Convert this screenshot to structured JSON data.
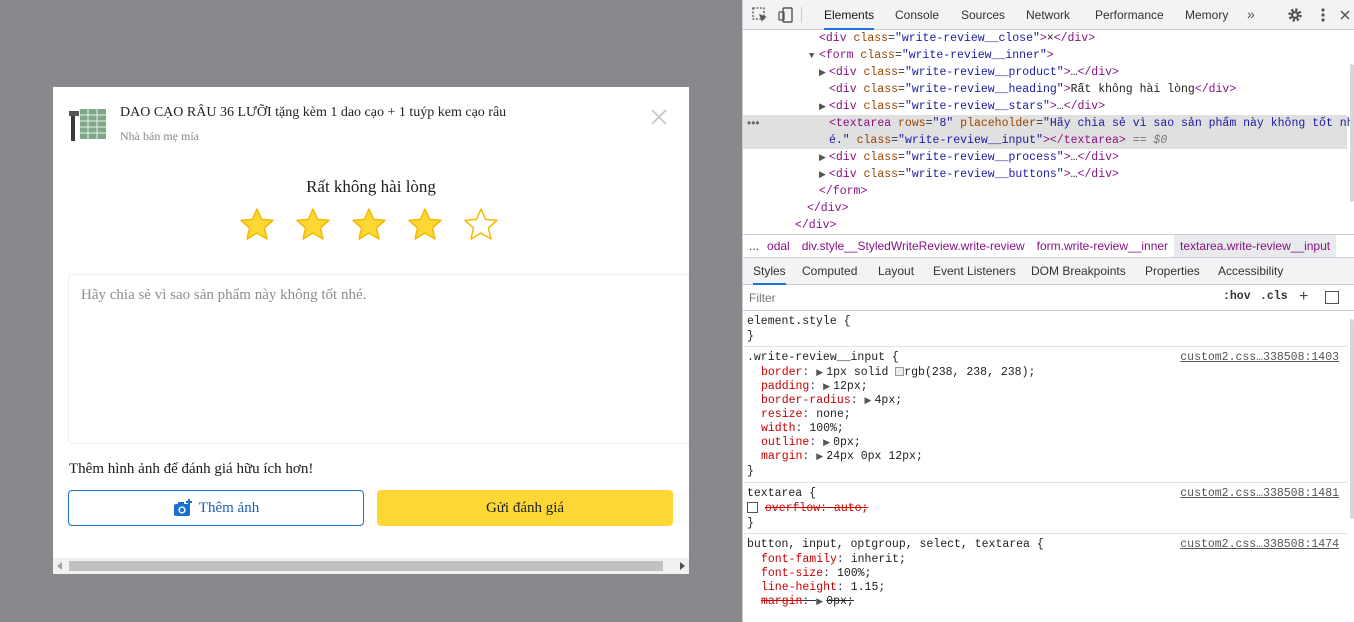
{
  "modal": {
    "product_name": "DAO CẠO RÂU 36 LƯỠI tặng kèm 1 dao cạo + 1 tuýp kem cạo râu",
    "seller": "Nhà bán mẹ mía",
    "close_glyph": "×",
    "heading": "Rất không hài lòng",
    "rating": 4,
    "rating_max": 5,
    "review_placeholder": "Hãy chia sẻ vì sao sản phẩm này không tốt nhé.",
    "process_text": "Thêm hình ảnh để đánh giá hữu ích hơn!",
    "add_photo_label": "Thêm ảnh",
    "submit_label": "Gửi đánh giá",
    "colors": {
      "star": "#fdd835",
      "star_stroke": "#f5b800",
      "submit_bg": "#fdd835",
      "add_border": "#1a73c8",
      "backdrop": "#88898c"
    }
  },
  "devtools": {
    "tabs": [
      "Elements",
      "Console",
      "Sources",
      "Network",
      "Performance",
      "Memory"
    ],
    "active_tab": "Elements",
    "more_tabs": "»",
    "dom": {
      "l1": {
        "tag": "div",
        "class_attr": "class",
        "class_val": "\"write-review__close\"",
        "text": "×",
        "close": "</div>"
      },
      "l2": {
        "tag": "form",
        "class_attr": "class",
        "class_val": "\"write-review__inner\""
      },
      "l3": {
        "tag": "div",
        "class_attr": "class",
        "class_val": "\"write-review__product\"",
        "text": "…",
        "close": "</div>"
      },
      "l4": {
        "tag": "div",
        "class_attr": "class",
        "class_val": "\"write-review__heading\"",
        "text": "Rất không hài lòng",
        "close": "</div>"
      },
      "l5": {
        "tag": "div",
        "class_attr": "class",
        "class_val": "\"write-review__stars\"",
        "text": "…",
        "close": "</div>"
      },
      "l6": {
        "tag": "textarea",
        "rows_attr": "rows",
        "rows_val": "\"8\"",
        "ph_attr": "placeholder",
        "ph_val_1": "\"Hãy chia sẻ vì sao sản phẩm này không tốt nh",
        "ph_val_2": "é.\"",
        "class_attr": "class",
        "class_val": "\"write-review__input\"",
        "close": "</textarea>",
        "eq": "== $0"
      },
      "l7": {
        "tag": "div",
        "class_attr": "class",
        "class_val": "\"write-review__process\"",
        "text": "…",
        "close": "</div>"
      },
      "l8": {
        "tag": "div",
        "class_attr": "class",
        "class_val": "\"write-review__buttons\"",
        "text": "…",
        "close": "</div>"
      },
      "l9": "</form>",
      "l10": "</div>",
      "l11": "</div>"
    },
    "gutter_dots": "•••",
    "breadcrumbs": {
      "dots": "...",
      "items": [
        "odal",
        "div.style__StyledWriteReview.write-review",
        "form.write-review__inner",
        "textarea.write-review__input"
      ]
    },
    "subtabs": [
      "Styles",
      "Computed",
      "Layout",
      "Event Listeners",
      "DOM Breakpoints",
      "Properties",
      "Accessibility"
    ],
    "active_subtab": "Styles",
    "filter_placeholder": "Filter",
    "hov": ":hov",
    "cls": ".cls",
    "plus": "+",
    "styles": {
      "element_style": "element.style {",
      "brace_close": "}",
      "rule1": {
        "selector": ".write-review__input {",
        "source": "custom2.css…338508:1403",
        "props": [
          {
            "name": "border",
            "value": "1px solid ",
            "extra": "rgb(238, 238, 238);"
          },
          {
            "name": "padding",
            "value": "12px;"
          },
          {
            "name": "border-radius",
            "value": "4px;"
          },
          {
            "name": "resize",
            "value": "none;"
          },
          {
            "name": "width",
            "value": "100%;"
          },
          {
            "name": "outline",
            "value": "0px;"
          },
          {
            "name": "margin",
            "value": "24px 0px 12px;"
          }
        ]
      },
      "rule2": {
        "selector": "textarea {",
        "source": "custom2.css…338508:1481",
        "prop": "overflow: auto;"
      },
      "rule3": {
        "selector": "button, input, optgroup, select, textarea {",
        "source": "custom2.css…338508:1474",
        "props": [
          {
            "name": "font-family",
            "value": "inherit;"
          },
          {
            "name": "font-size",
            "value": "100%;"
          },
          {
            "name": "line-height",
            "value": "1.15;"
          },
          {
            "name": "margin",
            "value": "0px;"
          }
        ]
      }
    }
  }
}
